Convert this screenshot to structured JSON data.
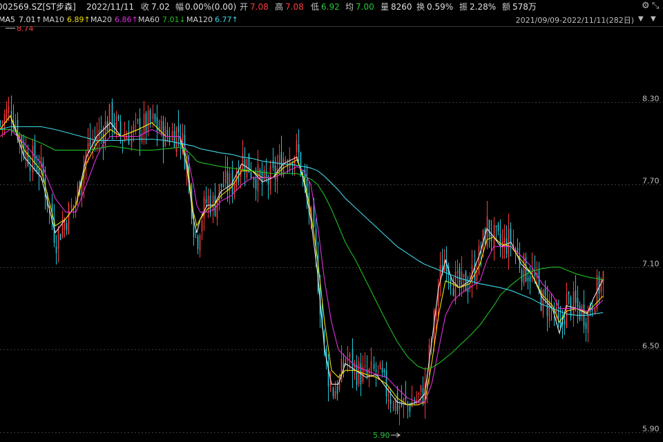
{
  "quote": {
    "code": "002569.SZ[ST步森]",
    "date": "2022/11/11",
    "close_label": "收",
    "close": "7.02",
    "change_label": "幅",
    "change": "0.00%(0.00)",
    "open_label": "开",
    "open": "7.08",
    "high_label": "高",
    "high": "7.08",
    "low_label": "低",
    "low": "6.92",
    "avg_label": "均",
    "avg": "7.00",
    "volume_label": "量",
    "volume": "8260",
    "turnover_label": "换",
    "turnover": "0.59%",
    "amplitude_label": "振",
    "amplitude": "2.28%",
    "amount_label": "额",
    "amount": "578万"
  },
  "ma_legend": [
    {
      "label": "MA5",
      "value": "7.01↑",
      "color": "#e6e6e6"
    },
    {
      "label": "MA10",
      "value": "6.89↑",
      "color": "#f0e000"
    },
    {
      "label": "MA20",
      "value": "6.86↑",
      "color": "#e030e0"
    },
    {
      "label": "MA60",
      "value": "7.01↓",
      "color": "#20c020"
    },
    {
      "label": "MA120",
      "value": "6.77↑",
      "color": "#40d8e8"
    }
  ],
  "range": "2021/09/09-2022/11/11(282日)",
  "icons": {
    "settings": "gear-icon",
    "dropdown": "chevron-down-icon",
    "collapse": "collapse-icon"
  },
  "colors": {
    "up": "#ff3b3b",
    "down": "#20c8d8",
    "grid": "#3a3a3a",
    "background": "#000000"
  },
  "chart_data": {
    "type": "candlestick",
    "title": "",
    "xlabel": "",
    "ylabel": "",
    "ylim": [
      5.85,
      8.85
    ],
    "yticks": [
      "8.30",
      "7.70",
      "7.10",
      "6.50",
      "5.90"
    ],
    "grid": true,
    "max_label": "8.74",
    "min_label": "5.90",
    "n_days": 282,
    "x": [
      0,
      15,
      35,
      60,
      80,
      95,
      110,
      125,
      140,
      150,
      160,
      175,
      200,
      220,
      240,
      260,
      270,
      280,
      285,
      290,
      300,
      310,
      320,
      335,
      350,
      365,
      380,
      395,
      410,
      430,
      440,
      450,
      460,
      470,
      480,
      490,
      500,
      515,
      530,
      545,
      560,
      575,
      590,
      605,
      615,
      625,
      635,
      645,
      655,
      665,
      680,
      695,
      705,
      715,
      725,
      740,
      755,
      770,
      785,
      800,
      810,
      820,
      835,
      850,
      860,
      873
    ],
    "close": [
      8.15,
      8.25,
      7.95,
      7.8,
      7.3,
      7.45,
      7.6,
      7.95,
      8.05,
      8.1,
      8.2,
      8.05,
      8.1,
      8.15,
      8.05,
      8.1,
      7.85,
      7.4,
      7.3,
      7.45,
      7.6,
      7.55,
      7.7,
      7.7,
      7.9,
      7.8,
      7.7,
      7.75,
      7.9,
      7.95,
      7.7,
      7.45,
      7.0,
      6.45,
      6.2,
      6.25,
      6.45,
      6.35,
      6.3,
      6.35,
      6.2,
      6.1,
      6.1,
      6.15,
      6.2,
      6.6,
      7.0,
      7.2,
      7.0,
      6.95,
      7.0,
      7.2,
      7.4,
      7.3,
      7.25,
      7.3,
      7.1,
      7.05,
      6.85,
      6.8,
      6.6,
      6.85,
      6.8,
      6.75,
      6.9,
      7.02
    ],
    "ma": {
      "MA5": [
        8.1,
        8.2,
        7.9,
        7.75,
        7.35,
        7.45,
        7.55,
        7.9,
        8.05,
        8.1,
        8.15,
        8.05,
        8.1,
        8.15,
        8.05,
        8.05,
        7.85,
        7.45,
        7.35,
        7.45,
        7.55,
        7.55,
        7.65,
        7.7,
        7.85,
        7.8,
        7.72,
        7.75,
        7.85,
        7.9,
        7.72,
        7.45,
        7.05,
        6.5,
        6.25,
        6.25,
        6.4,
        6.35,
        6.3,
        6.32,
        6.22,
        6.12,
        6.1,
        6.12,
        6.18,
        6.55,
        6.95,
        7.15,
        7.0,
        6.95,
        7.0,
        7.2,
        7.38,
        7.32,
        7.25,
        7.28,
        7.12,
        7.05,
        6.88,
        6.8,
        6.62,
        6.82,
        6.8,
        6.76,
        6.88,
        7.01
      ],
      "MA10": [
        8.1,
        8.2,
        7.95,
        7.8,
        7.4,
        7.45,
        7.55,
        7.85,
        8.0,
        8.05,
        8.1,
        8.05,
        8.1,
        8.15,
        8.05,
        8.05,
        7.9,
        7.5,
        7.4,
        7.45,
        7.52,
        7.55,
        7.62,
        7.68,
        7.8,
        7.8,
        7.75,
        7.75,
        7.82,
        7.88,
        7.75,
        7.5,
        7.15,
        6.7,
        6.35,
        6.3,
        6.35,
        6.35,
        6.32,
        6.3,
        6.25,
        6.15,
        6.1,
        6.1,
        6.12,
        6.4,
        6.75,
        7.0,
        6.98,
        6.95,
        6.98,
        7.12,
        7.3,
        7.32,
        7.27,
        7.25,
        7.15,
        7.05,
        6.9,
        6.82,
        6.7,
        6.78,
        6.8,
        6.77,
        6.82,
        6.89
      ],
      "MA20": [
        8.05,
        8.1,
        8.0,
        7.85,
        7.6,
        7.5,
        7.5,
        7.7,
        7.9,
        8.0,
        8.05,
        8.05,
        8.05,
        8.1,
        8.05,
        8.05,
        7.95,
        7.7,
        7.55,
        7.5,
        7.5,
        7.52,
        7.58,
        7.62,
        7.7,
        7.75,
        7.75,
        7.75,
        7.78,
        7.83,
        7.8,
        7.7,
        7.4,
        7.0,
        6.7,
        6.5,
        6.45,
        6.38,
        6.35,
        6.32,
        6.3,
        6.22,
        6.15,
        6.12,
        6.12,
        6.25,
        6.5,
        6.75,
        6.85,
        6.9,
        6.95,
        7.0,
        7.15,
        7.25,
        7.25,
        7.25,
        7.18,
        7.1,
        6.98,
        6.9,
        6.8,
        6.8,
        6.8,
        6.78,
        6.8,
        6.86
      ],
      "MA60": [
        8.1,
        8.1,
        8.05,
        8.0,
        7.95,
        7.95,
        7.95,
        7.95,
        7.96,
        7.97,
        7.98,
        7.97,
        7.95,
        7.95,
        7.96,
        7.97,
        7.95,
        7.9,
        7.87,
        7.86,
        7.85,
        7.84,
        7.83,
        7.82,
        7.81,
        7.8,
        7.79,
        7.78,
        7.78,
        7.78,
        7.76,
        7.74,
        7.7,
        7.62,
        7.52,
        7.4,
        7.28,
        7.15,
        7.0,
        6.85,
        6.7,
        6.56,
        6.45,
        6.38,
        6.36,
        6.37,
        6.4,
        6.44,
        6.48,
        6.53,
        6.6,
        6.68,
        6.75,
        6.82,
        6.9,
        6.97,
        7.03,
        7.07,
        7.09,
        7.1,
        7.1,
        7.08,
        7.05,
        7.03,
        7.02,
        7.01
      ],
      "MA120": [
        8.1,
        8.12,
        8.12,
        8.12,
        8.1,
        8.08,
        8.06,
        8.04,
        8.02,
        8.02,
        8.02,
        8.02,
        8.03,
        8.03,
        8.02,
        8.0,
        7.99,
        7.98,
        7.97,
        7.96,
        7.95,
        7.94,
        7.93,
        7.92,
        7.9,
        7.89,
        7.87,
        7.86,
        7.85,
        7.84,
        7.83,
        7.82,
        7.8,
        7.76,
        7.71,
        7.66,
        7.6,
        7.53,
        7.46,
        7.39,
        7.32,
        7.25,
        7.2,
        7.15,
        7.12,
        7.1,
        7.08,
        7.06,
        7.04,
        7.02,
        7.0,
        6.98,
        6.97,
        6.96,
        6.95,
        6.93,
        6.9,
        6.87,
        6.83,
        6.8,
        6.78,
        6.76,
        6.75,
        6.75,
        6.76,
        6.77
      ]
    }
  }
}
